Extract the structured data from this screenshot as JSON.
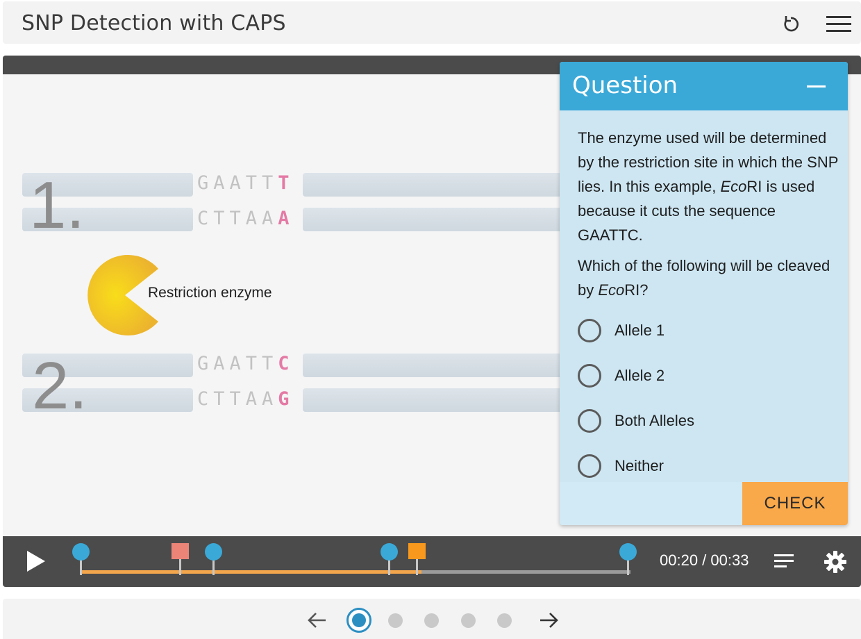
{
  "header": {
    "title": "SNP Detection with CAPS"
  },
  "illustration": {
    "allele1": {
      "number": "1.",
      "top_seq_prefix": "GAATT",
      "top_seq_snp": "T",
      "bottom_seq_prefix": "CTTAA",
      "bottom_seq_snp": "A"
    },
    "allele2": {
      "number": "2.",
      "top_seq_prefix": "GAATT",
      "top_seq_snp": "C",
      "bottom_seq_prefix": "CTTAA",
      "bottom_seq_snp": "G"
    },
    "enzyme_label": "Restriction enzyme"
  },
  "question": {
    "title": "Question",
    "para1_before": "The enzyme used will be determined by the restriction site in which the SNP lies. In this example, ",
    "para1_italic": "Eco",
    "para1_after": "RI is used because it cuts the sequence GAATTC.",
    "para2_before": "Which of the following will be cleaved by ",
    "para2_italic": "Eco",
    "para2_after": "RI?",
    "options": [
      "Allele 1",
      "Allele 2",
      "Both Alleles",
      "Neither"
    ],
    "check_label": "CHECK"
  },
  "player": {
    "time": "00:20 / 00:33",
    "progress_fraction": 0.62,
    "colors": {
      "accent": "#3aa9d8",
      "progress": "#f3a64c",
      "check": "#f9a84a",
      "snp": "#e47aa5"
    }
  },
  "pagination": {
    "pages": 5,
    "current": 1
  }
}
